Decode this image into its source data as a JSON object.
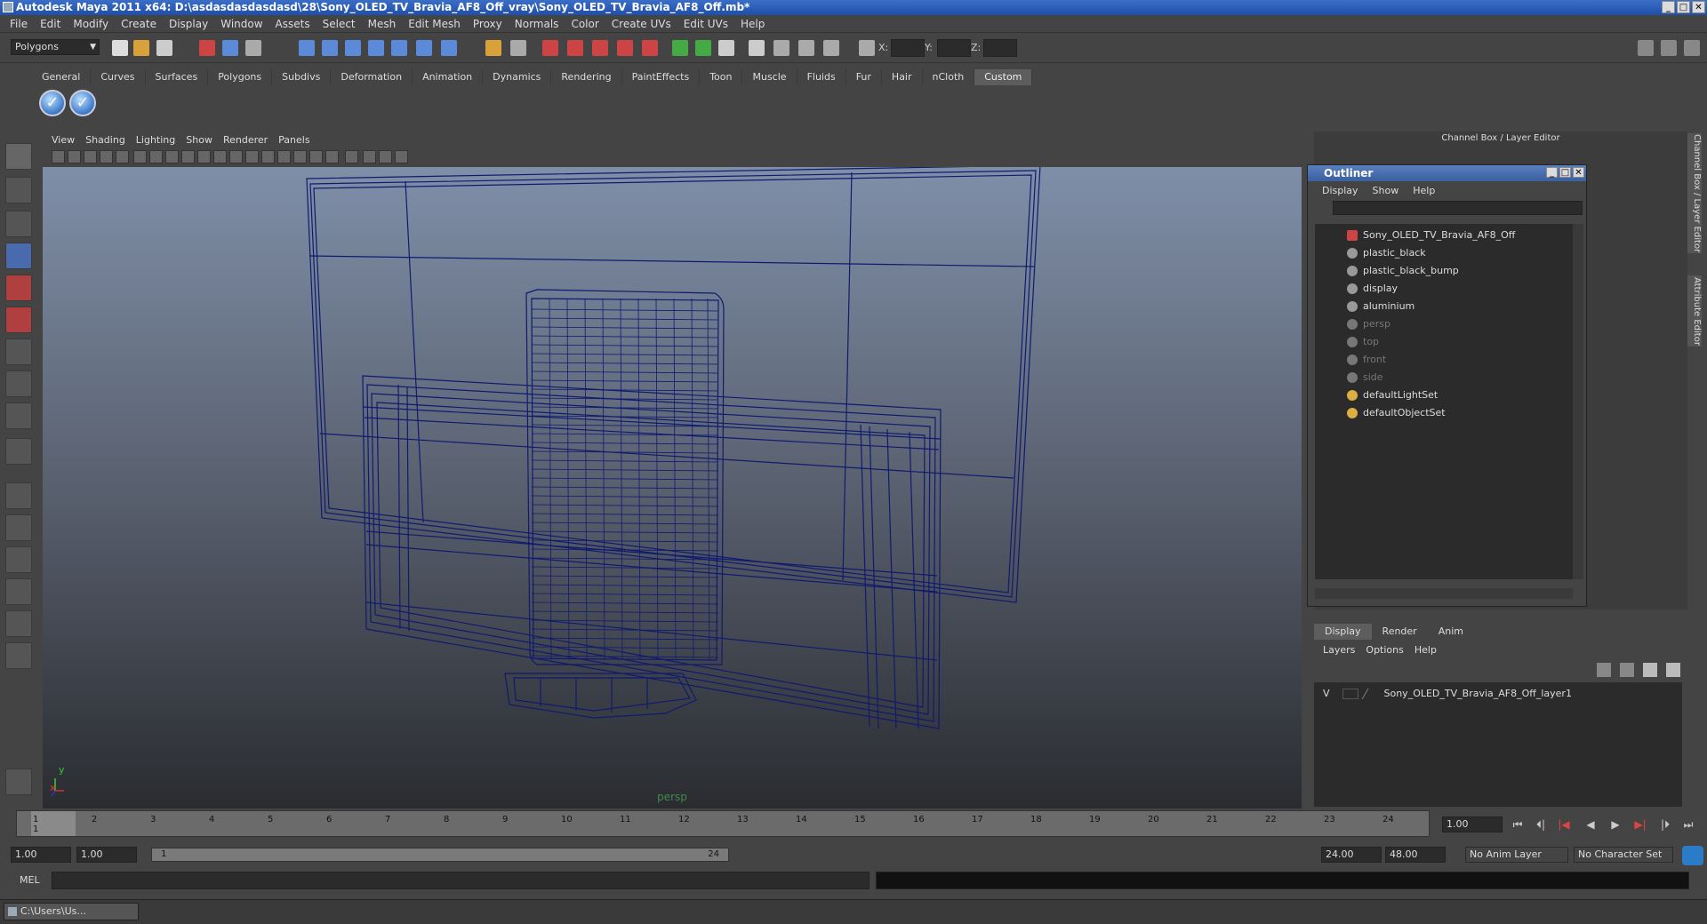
{
  "window": {
    "title": "Autodesk Maya 2011 x64: D:\\asdasdasdasdasd\\28\\Sony_OLED_TV_Bravia_AF8_Off_vray\\Sony_OLED_TV_Bravia_AF8_Off.mb*",
    "minimize": "_",
    "maximize": "□",
    "close": "✕"
  },
  "menubar": [
    "File",
    "Edit",
    "Modify",
    "Create",
    "Display",
    "Window",
    "Assets",
    "Select",
    "Mesh",
    "Edit Mesh",
    "Proxy",
    "Normals",
    "Color",
    "Create UVs",
    "Edit UVs",
    "Help"
  ],
  "statusline": {
    "mode": "Polygons",
    "x_label": "X:",
    "y_label": "Y:",
    "z_label": "Z:"
  },
  "shelf": {
    "tabs": [
      "General",
      "Curves",
      "Surfaces",
      "Polygons",
      "Subdivs",
      "Deformation",
      "Animation",
      "Dynamics",
      "Rendering",
      "PaintEffects",
      "Toon",
      "Muscle",
      "Fluids",
      "Fur",
      "Hair",
      "nCloth",
      "Custom"
    ],
    "active": "Custom"
  },
  "viewport": {
    "menu": [
      "View",
      "Shading",
      "Lighting",
      "Show",
      "Renderer",
      "Panels"
    ],
    "camera": "persp",
    "axis_x": "x",
    "axis_y": "y"
  },
  "right_panel": {
    "header": "Channel Box / Layer Editor",
    "side_tabs": [
      "Channel Box / Layer Editor",
      "Attribute Editor"
    ]
  },
  "outliner": {
    "title": "Outliner",
    "menu": [
      "Display",
      "Show",
      "Help"
    ],
    "items": [
      {
        "label": "Sony_OLED_TV_Bravia_AF8_Off",
        "dim": false
      },
      {
        "label": "plastic_black",
        "dim": false
      },
      {
        "label": "plastic_black_bump",
        "dim": false
      },
      {
        "label": "display",
        "dim": false
      },
      {
        "label": "aluminium",
        "dim": false
      },
      {
        "label": "persp",
        "dim": true
      },
      {
        "label": "top",
        "dim": true
      },
      {
        "label": "front",
        "dim": true
      },
      {
        "label": "side",
        "dim": true
      },
      {
        "label": "defaultLightSet",
        "dim": false
      },
      {
        "label": "defaultObjectSet",
        "dim": false
      }
    ]
  },
  "layer_editor": {
    "tabs": [
      "Display",
      "Render",
      "Anim"
    ],
    "active": "Display",
    "menu": [
      "Layers",
      "Options",
      "Help"
    ],
    "layer": {
      "visible": "V",
      "name": "Sony_OLED_TV_Bravia_AF8_Off_layer1"
    }
  },
  "timeline": {
    "ticks": [
      "1",
      "2",
      "3",
      "4",
      "5",
      "6",
      "7",
      "8",
      "9",
      "10",
      "11",
      "12",
      "13",
      "14",
      "15",
      "16",
      "17",
      "18",
      "19",
      "20",
      "21",
      "22",
      "23",
      "24"
    ],
    "current_marker": "1",
    "current_frame": "1.00"
  },
  "range": {
    "start": "1.00",
    "playback_start": "1.00",
    "slider_start": "1",
    "slider_end": "24",
    "playback_end": "24.00",
    "end": "48.00",
    "anim_layer": "No Anim Layer",
    "character_set": "No Character Set"
  },
  "commandline": {
    "label": "MEL"
  },
  "taskbar": {
    "item": "C:\\Users\\Us..."
  }
}
